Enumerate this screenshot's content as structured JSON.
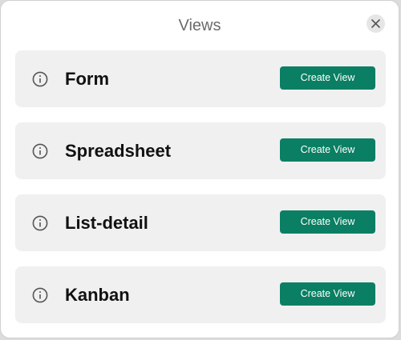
{
  "dialog": {
    "title": "Views",
    "close_icon": "close-icon"
  },
  "views": [
    {
      "name": "Form",
      "button_label": "Create View",
      "icon": "info-icon"
    },
    {
      "name": "Spreadsheet",
      "button_label": "Create View",
      "icon": "info-icon"
    },
    {
      "name": "List-detail",
      "button_label": "Create View",
      "icon": "info-icon"
    },
    {
      "name": "Kanban",
      "button_label": "Create View",
      "icon": "info-icon"
    }
  ],
  "colors": {
    "button_bg": "#0b7f63",
    "card_bg": "#f0f0f0",
    "title_text": "#6b6b6b"
  }
}
